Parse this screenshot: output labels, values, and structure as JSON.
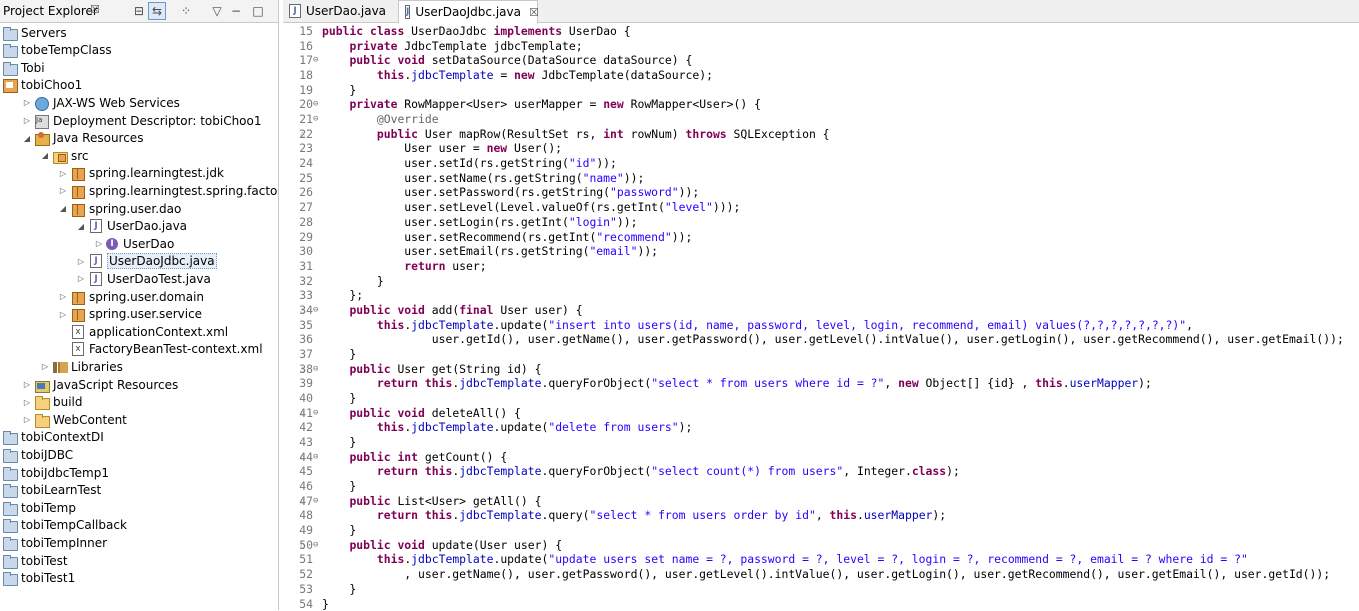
{
  "project_explorer": {
    "title": "Project Explorer",
    "close": "☒",
    "toolbar": [
      "collapse-all",
      "link-with-editor",
      "filters",
      "view-menu",
      "minimize",
      "maximize"
    ],
    "items": [
      {
        "label": "Servers",
        "icon": "folder-icon",
        "indent": 0,
        "twisty": ""
      },
      {
        "label": "tobeTempClass",
        "icon": "folder-icon",
        "indent": 0,
        "twisty": ""
      },
      {
        "label": "Tobi",
        "icon": "folder-icon",
        "indent": 0,
        "twisty": ""
      },
      {
        "label": "tobiChoo1",
        "icon": "project-icon",
        "indent": 0,
        "twisty": ""
      },
      {
        "label": "JAX-WS Web Services",
        "icon": "web-services-icon",
        "indent": 1,
        "twisty": "▷"
      },
      {
        "label": "Deployment Descriptor: tobiChoo1",
        "icon": "deployment-descriptor-icon",
        "indent": 1,
        "twisty": "▷"
      },
      {
        "label": "Java Resources",
        "icon": "java-resources-icon",
        "indent": 1,
        "twisty": "◢"
      },
      {
        "label": "src",
        "icon": "source-folder-icon",
        "indent": 2,
        "twisty": "◢"
      },
      {
        "label": "spring.learningtest.jdk",
        "icon": "package-icon",
        "indent": 3,
        "twisty": "▷"
      },
      {
        "label": "spring.learningtest.spring.factorybean",
        "icon": "package-icon",
        "indent": 3,
        "twisty": "▷"
      },
      {
        "label": "spring.user.dao",
        "icon": "package-icon",
        "indent": 3,
        "twisty": "◢"
      },
      {
        "label": "UserDao.java",
        "icon": "java-file-icon",
        "indent": 4,
        "twisty": "◢"
      },
      {
        "label": "UserDao",
        "icon": "interface-icon",
        "indent": 5,
        "twisty": "▷"
      },
      {
        "label": "UserDaoJdbc.java",
        "icon": "java-file-icon",
        "indent": 4,
        "twisty": "▷",
        "selected": true
      },
      {
        "label": "UserDaoTest.java",
        "icon": "java-file-icon",
        "indent": 4,
        "twisty": "▷"
      },
      {
        "label": "spring.user.domain",
        "icon": "package-icon",
        "indent": 3,
        "twisty": "▷"
      },
      {
        "label": "spring.user.service",
        "icon": "package-icon",
        "indent": 3,
        "twisty": "▷"
      },
      {
        "label": "applicationContext.xml",
        "icon": "xml-file-icon",
        "indent": 3,
        "twisty": ""
      },
      {
        "label": "FactoryBeanTest-context.xml",
        "icon": "xml-file-icon",
        "indent": 3,
        "twisty": ""
      },
      {
        "label": "Libraries",
        "icon": "libraries-icon",
        "indent": 2,
        "twisty": "▷"
      },
      {
        "label": "JavaScript Resources",
        "icon": "javascript-resources-icon",
        "indent": 1,
        "twisty": "▷"
      },
      {
        "label": "build",
        "icon": "folder-open-icon",
        "indent": 1,
        "twisty": "▷"
      },
      {
        "label": "WebContent",
        "icon": "folder-open-icon",
        "indent": 1,
        "twisty": "▷"
      },
      {
        "label": "tobiContextDI",
        "icon": "folder-icon",
        "indent": 0,
        "twisty": ""
      },
      {
        "label": "tobiJDBC",
        "icon": "folder-icon",
        "indent": 0,
        "twisty": ""
      },
      {
        "label": "tobiJdbcTemp1",
        "icon": "folder-icon",
        "indent": 0,
        "twisty": ""
      },
      {
        "label": "tobiLearnTest",
        "icon": "folder-icon",
        "indent": 0,
        "twisty": ""
      },
      {
        "label": "tobiTemp",
        "icon": "folder-icon",
        "indent": 0,
        "twisty": ""
      },
      {
        "label": "tobiTempCallback",
        "icon": "folder-icon",
        "indent": 0,
        "twisty": ""
      },
      {
        "label": "tobiTempInner",
        "icon": "folder-icon",
        "indent": 0,
        "twisty": ""
      },
      {
        "label": "tobiTest",
        "icon": "folder-icon",
        "indent": 0,
        "twisty": ""
      },
      {
        "label": "tobiTest1",
        "icon": "folder-icon",
        "indent": 0,
        "twisty": ""
      }
    ]
  },
  "editor": {
    "tabs": [
      {
        "label": "UserDao.java",
        "active": false,
        "close": ""
      },
      {
        "label": "UserDaoJdbc.java",
        "active": true,
        "close": "☒"
      }
    ],
    "lines": [
      {
        "n": "15",
        "fold": "",
        "gutter": "",
        "code": "public class UserDaoJdbc implements UserDao {"
      },
      {
        "n": "16",
        "fold": "",
        "gutter": "",
        "code": "    private JdbcTemplate jdbcTemplate;"
      },
      {
        "n": "17",
        "fold": "⊖",
        "gutter": "",
        "code": "    public void setDataSource(DataSource dataSource) {"
      },
      {
        "n": "18",
        "fold": "",
        "gutter": "",
        "code": "        this.jdbcTemplate = new JdbcTemplate(dataSource);"
      },
      {
        "n": "19",
        "fold": "",
        "gutter": "",
        "code": "    }"
      },
      {
        "n": "20",
        "fold": "⊖",
        "gutter": "",
        "code": "    private RowMapper<User> userMapper = new RowMapper<User>() {"
      },
      {
        "n": "21",
        "fold": "⊖",
        "gutter": "",
        "code": "        @Override"
      },
      {
        "n": "22",
        "fold": "",
        "gutter": "△",
        "code": "        public User mapRow(ResultSet rs, int rowNum) throws SQLException {"
      },
      {
        "n": "23",
        "fold": "",
        "gutter": "",
        "code": "            User user = new User();"
      },
      {
        "n": "24",
        "fold": "",
        "gutter": "",
        "code": "            user.setId(rs.getString(\"id\"));"
      },
      {
        "n": "25",
        "fold": "",
        "gutter": "",
        "code": "            user.setName(rs.getString(\"name\"));"
      },
      {
        "n": "26",
        "fold": "",
        "gutter": "",
        "code": "            user.setPassword(rs.getString(\"password\"));"
      },
      {
        "n": "27",
        "fold": "",
        "gutter": "",
        "code": "            user.setLevel(Level.valueOf(rs.getInt(\"level\")));"
      },
      {
        "n": "28",
        "fold": "",
        "gutter": "",
        "code": "            user.setLogin(rs.getInt(\"login\"));"
      },
      {
        "n": "29",
        "fold": "",
        "gutter": "",
        "code": "            user.setRecommend(rs.getInt(\"recommend\"));"
      },
      {
        "n": "30",
        "fold": "",
        "gutter": "",
        "code": "            user.setEmail(rs.getString(\"email\"));"
      },
      {
        "n": "31",
        "fold": "",
        "gutter": "",
        "code": "            return user;"
      },
      {
        "n": "32",
        "fold": "",
        "gutter": "",
        "code": "        }"
      },
      {
        "n": "33",
        "fold": "",
        "gutter": "",
        "code": "    };"
      },
      {
        "n": "34",
        "fold": "⊖",
        "gutter": "△",
        "code": "    public void add(final User user) {"
      },
      {
        "n": "35",
        "fold": "",
        "gutter": "",
        "code": "        this.jdbcTemplate.update(\"insert into users(id, name, password, level, login, recommend, email) values(?,?,?,?,?,?,?)\","
      },
      {
        "n": "36",
        "fold": "",
        "gutter": "",
        "code": "                user.getId(), user.getName(), user.getPassword(), user.getLevel().intValue(), user.getLogin(), user.getRecommend(), user.getEmail());"
      },
      {
        "n": "37",
        "fold": "",
        "gutter": "",
        "code": "    }"
      },
      {
        "n": "38",
        "fold": "⊖",
        "gutter": "△",
        "code": "    public User get(String id) {"
      },
      {
        "n": "39",
        "fold": "",
        "gutter": "",
        "code": "        return this.jdbcTemplate.queryForObject(\"select * from users where id = ?\", new Object[] {id} , this.userMapper);"
      },
      {
        "n": "40",
        "fold": "",
        "gutter": "",
        "code": "    }"
      },
      {
        "n": "41",
        "fold": "⊖",
        "gutter": "△",
        "code": "    public void deleteAll() {"
      },
      {
        "n": "42",
        "fold": "",
        "gutter": "",
        "code": "        this.jdbcTemplate.update(\"delete from users\");"
      },
      {
        "n": "43",
        "fold": "",
        "gutter": "",
        "code": "    }"
      },
      {
        "n": "44",
        "fold": "⊖",
        "gutter": "△",
        "code": "    public int getCount() {"
      },
      {
        "n": "45",
        "fold": "",
        "gutter": "",
        "code": "        return this.jdbcTemplate.queryForObject(\"select count(*) from users\", Integer.class);"
      },
      {
        "n": "46",
        "fold": "",
        "gutter": "",
        "code": "    }"
      },
      {
        "n": "47",
        "fold": "⊖",
        "gutter": "△",
        "code": "    public List<User> getAll() {"
      },
      {
        "n": "48",
        "fold": "",
        "gutter": "",
        "code": "        return this.jdbcTemplate.query(\"select * from users order by id\", this.userMapper);"
      },
      {
        "n": "49",
        "fold": "",
        "gutter": "",
        "code": "    }"
      },
      {
        "n": "50",
        "fold": "⊖",
        "gutter": "△",
        "code": "    public void update(User user) {"
      },
      {
        "n": "51",
        "fold": "",
        "gutter": "",
        "code": "        this.jdbcTemplate.update(\"update users set name = ?, password = ?, level = ?, login = ?, recommend = ?, email = ? where id = ?\""
      },
      {
        "n": "52",
        "fold": "",
        "gutter": "",
        "code": "            , user.getName(), user.getPassword(), user.getLevel().intValue(), user.getLogin(), user.getRecommend(), user.getEmail(), user.getId());"
      },
      {
        "n": "53",
        "fold": "",
        "gutter": "",
        "code": "    }"
      },
      {
        "n": "54",
        "fold": "",
        "gutter": "",
        "code": "}"
      }
    ]
  },
  "colors": {
    "keyword": "#7f0055",
    "string": "#2a00ff",
    "field": "#0000c0",
    "annotation": "#646464",
    "selection_bg": "#e6eef8"
  }
}
